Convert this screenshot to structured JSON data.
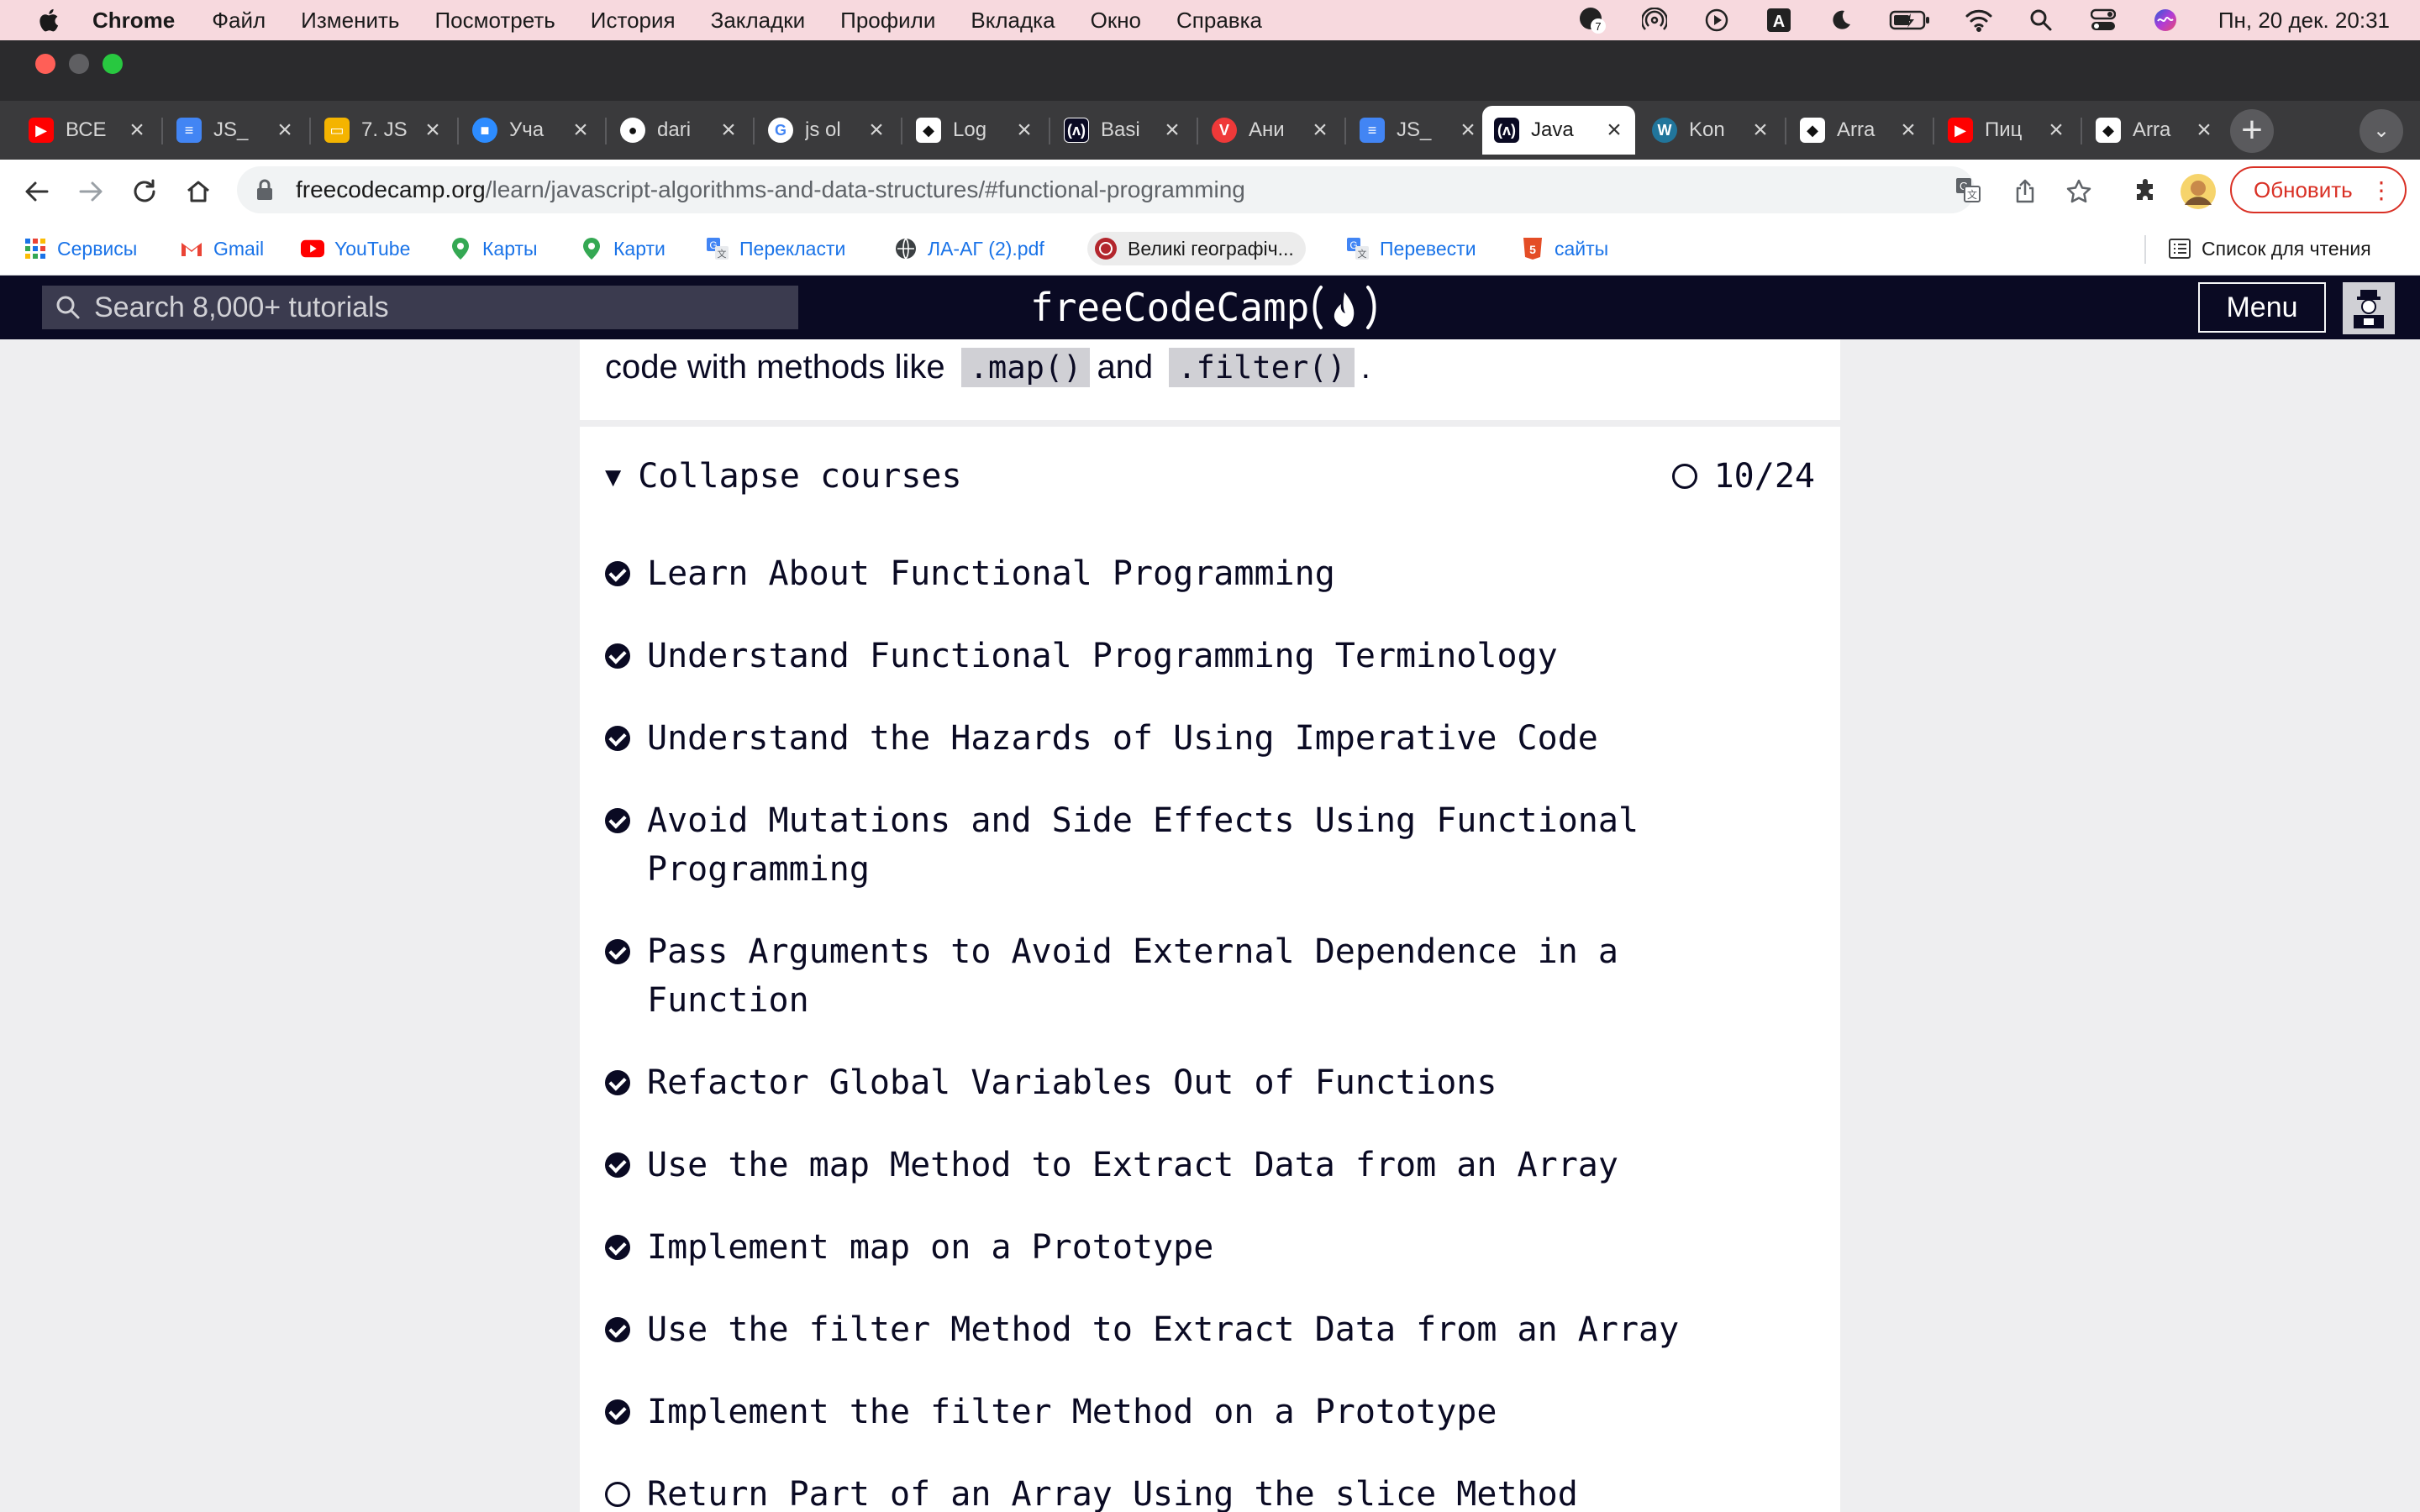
{
  "menubar": {
    "app": "Chrome",
    "items": [
      "Файл",
      "Изменить",
      "Посмотреть",
      "История",
      "Закладки",
      "Профили",
      "Вкладка",
      "Окно",
      "Справка"
    ],
    "clock": "Пн, 20 дек.  20:31",
    "notification_badge": "7",
    "input_source": "A"
  },
  "tabs": [
    {
      "title": "ВСЕ",
      "icon": "youtube-icon",
      "color": "#ff0000"
    },
    {
      "title": "JS_",
      "icon": "docs-icon",
      "color": "#4285f4"
    },
    {
      "title": "7. JS",
      "icon": "slides-icon",
      "color": "#f4b400"
    },
    {
      "title": "Уча",
      "icon": "zoom-icon",
      "color": "#2d8cff"
    },
    {
      "title": "dari",
      "icon": "github-icon",
      "color": "#ffffff"
    },
    {
      "title": "js ol",
      "icon": "google-icon",
      "color": "#ffffff"
    },
    {
      "title": "Log",
      "icon": "codewars-icon",
      "color": "#ffffff"
    },
    {
      "title": "Basi",
      "icon": "fcc-icon",
      "color": "#0a0a23"
    },
    {
      "title": "Ани",
      "icon": "vivaldi-icon",
      "color": "#ef3939"
    },
    {
      "title": "JS_",
      "icon": "docs-icon",
      "color": "#4285f4"
    },
    {
      "title": "Java",
      "icon": "fcc-icon",
      "color": "#0a0a23",
      "active": true
    },
    {
      "title": "Kon",
      "icon": "wordpress-icon",
      "color": "#21759b"
    },
    {
      "title": "Arra",
      "icon": "codewars-icon",
      "color": "#ffffff"
    },
    {
      "title": "Пиц",
      "icon": "youtube-icon",
      "color": "#ff0000"
    },
    {
      "title": "Arra",
      "icon": "codewars-icon",
      "color": "#ffffff"
    }
  ],
  "toolbar": {
    "url_host": "freecodecamp.org",
    "url_path": "/learn/javascript-algorithms-and-data-structures/#functional-programming",
    "update_label": "Обновить"
  },
  "bookmarks": {
    "items": [
      "Сервисы",
      "Gmail",
      "YouTube",
      "Карты",
      "Карти",
      "Перекласти",
      "ЛА-АГ (2).pdf",
      "Великі географіч...",
      "Перевести",
      "сайты"
    ],
    "reading_list": "Список для чтения"
  },
  "fcc": {
    "search_placeholder": "Search 8,000+ tutorials",
    "logo": "freeCodeCamp",
    "menu_label": "Menu"
  },
  "intro": {
    "before": "code with methods like",
    "code1": ".map()",
    "middle": "and",
    "code2": ".filter()",
    "after": "."
  },
  "courses": {
    "collapse_label": "Collapse courses",
    "progress": "10/24",
    "completed": 10,
    "total": 24,
    "lessons": [
      {
        "title": "Learn About Functional Programming",
        "done": true
      },
      {
        "title": "Understand Functional Programming Terminology",
        "done": true
      },
      {
        "title": "Understand the Hazards of Using Imperative Code",
        "done": true
      },
      {
        "title": "Avoid Mutations and Side Effects Using Functional Programming",
        "done": true
      },
      {
        "title": "Pass Arguments to Avoid External Dependence in a Function",
        "done": true
      },
      {
        "title": "Refactor Global Variables Out of Functions",
        "done": true
      },
      {
        "title": "Use the map Method to Extract Data from an Array",
        "done": true
      },
      {
        "title": "Implement map on a Prototype",
        "done": true
      },
      {
        "title": "Use the filter Method to Extract Data from an Array",
        "done": true
      },
      {
        "title": "Implement the filter Method on a Prototype",
        "done": true
      },
      {
        "title": "Return Part of an Array Using the slice Method",
        "done": false
      }
    ]
  },
  "colors": {
    "menubar": "#f7d9de",
    "fcc_nav": "#0a0a23",
    "update_red": "#d93025"
  }
}
